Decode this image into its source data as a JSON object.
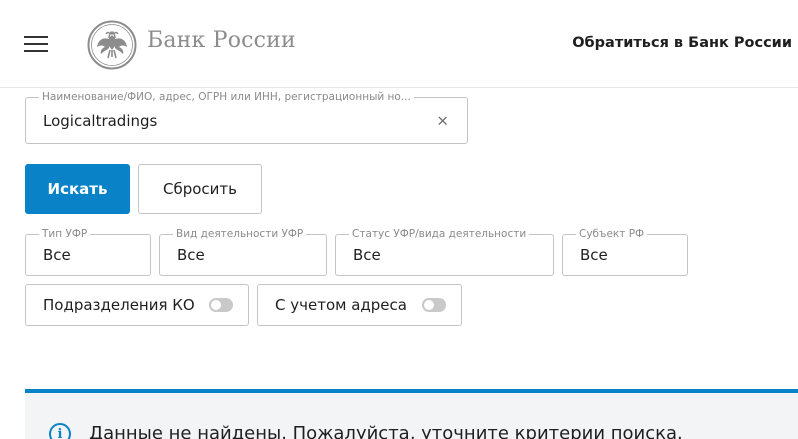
{
  "header": {
    "brand": "Банк России",
    "contact_link": "Обратиться в Банк России"
  },
  "search": {
    "legend": "Наименование/ФИО, адрес, ОГРН или ИНН, регистрационный но...",
    "value": "Logicaltradings",
    "clear_symbol": "×"
  },
  "buttons": {
    "search": "Искать",
    "reset": "Сбросить"
  },
  "filters": [
    {
      "legend": "Тип УФР",
      "value": "Все"
    },
    {
      "legend": "Вид деятельности УФР",
      "value": "Все"
    },
    {
      "legend": "Статус УФР/вида деятельности",
      "value": "Все"
    },
    {
      "legend": "Субъект РФ",
      "value": "Все"
    }
  ],
  "toggles": [
    {
      "label": "Подразделения КО",
      "on": false
    },
    {
      "label": "С учетом адреса",
      "on": false
    }
  ],
  "result": {
    "message": "Данные не найдены. Пожалуйста, уточните критерии поиска."
  },
  "colors": {
    "accent": "#0a82c8",
    "brand_text": "#8c8c8c"
  }
}
